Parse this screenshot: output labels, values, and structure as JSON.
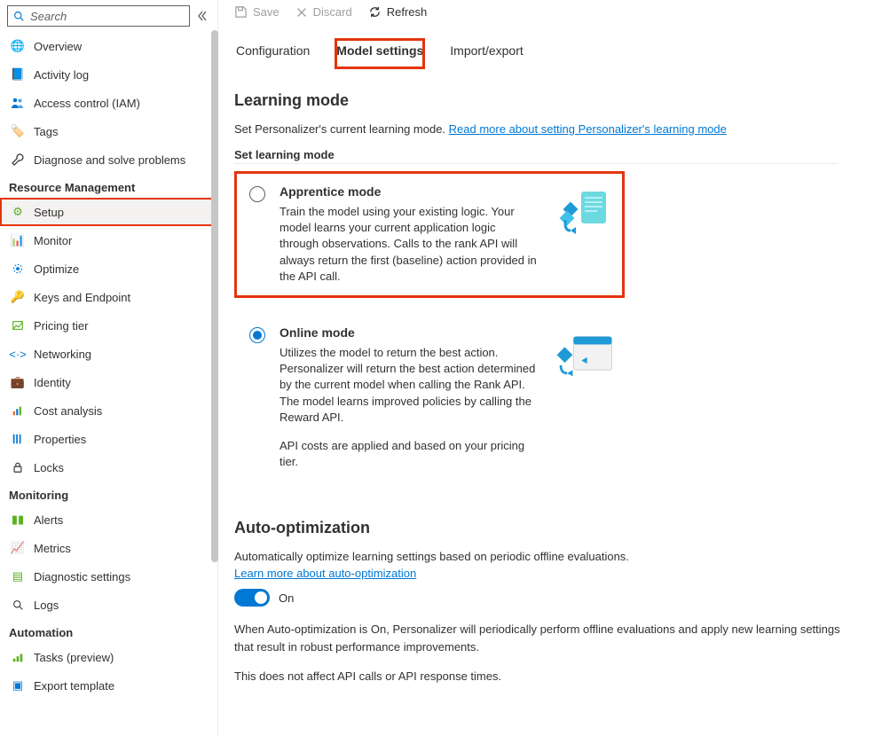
{
  "search": {
    "placeholder": "Search"
  },
  "toolbar": {
    "save": "Save",
    "discard": "Discard",
    "refresh": "Refresh"
  },
  "sidebar": {
    "items_top": [
      {
        "label": "Overview",
        "icon": "globe",
        "color": "#0396dd"
      },
      {
        "label": "Activity log",
        "icon": "log",
        "color": "#0078d4"
      },
      {
        "label": "Access control (IAM)",
        "icon": "people",
        "color": "#0078d4"
      },
      {
        "label": "Tags",
        "icon": "tag",
        "color": "#8c2db5"
      },
      {
        "label": "Diagnose and solve problems",
        "icon": "wrench",
        "color": "#323130"
      }
    ],
    "section_rm": "Resource Management",
    "items_rm": [
      {
        "label": "Setup",
        "icon": "gear",
        "color": "#5bb11f"
      },
      {
        "label": "Monitor",
        "icon": "monitor",
        "color": "#7b83eb"
      },
      {
        "label": "Optimize",
        "icon": "optimize",
        "color": "#0078d4"
      },
      {
        "label": "Keys and Endpoint",
        "icon": "key",
        "color": "#f7b500"
      },
      {
        "label": "Pricing tier",
        "icon": "pricing",
        "color": "#5bb11f"
      },
      {
        "label": "Networking",
        "icon": "network",
        "color": "#0078d4"
      },
      {
        "label": "Identity",
        "icon": "identity",
        "color": "#0078d4"
      },
      {
        "label": "Cost analysis",
        "icon": "cost",
        "color": "#0078d4"
      },
      {
        "label": "Properties",
        "icon": "props",
        "color": "#0078d4"
      },
      {
        "label": "Locks",
        "icon": "lock",
        "color": "#323130"
      }
    ],
    "section_mon": "Monitoring",
    "items_mon": [
      {
        "label": "Alerts",
        "icon": "alerts",
        "color": "#5bb11f"
      },
      {
        "label": "Metrics",
        "icon": "metrics",
        "color": "#0078d4"
      },
      {
        "label": "Diagnostic settings",
        "icon": "diag",
        "color": "#5bb11f"
      },
      {
        "label": "Logs",
        "icon": "logs",
        "color": "#323130"
      }
    ],
    "section_auto": "Automation",
    "items_auto": [
      {
        "label": "Tasks (preview)",
        "icon": "tasks",
        "color": "#5bb11f"
      },
      {
        "label": "Export template",
        "icon": "export",
        "color": "#0078d4"
      }
    ]
  },
  "tabs": {
    "configuration": "Configuration",
    "model_settings": "Model settings",
    "import_export": "Import/export"
  },
  "learning_mode": {
    "heading": "Learning mode",
    "desc_prefix": "Set Personalizer's current learning mode. ",
    "desc_link": "Read more about setting Personalizer's learning mode",
    "field_label": "Set learning mode",
    "apprentice": {
      "title": "Apprentice mode",
      "desc": "Train the model using your existing logic. Your model learns your current application logic through observations. Calls to the rank API will always return the first (baseline) action provided in the API call."
    },
    "online": {
      "title": "Online mode",
      "desc": "Utilizes the model to return the best action. Personalizer will return the best action determined by the current model when calling the Rank API. The model learns improved policies by calling the Reward API.",
      "extra": "API costs are applied and based on your pricing tier."
    }
  },
  "auto_opt": {
    "heading": "Auto-optimization",
    "desc": "Automatically optimize learning settings based on periodic offline evaluations.",
    "link": "Learn more about auto-optimization",
    "toggle_label": "On",
    "para1": "When Auto-optimization is On, Personalizer will periodically perform offline evaluations and apply new learning settings that result in robust performance improvements.",
    "para2": "This does not affect API calls or API response times."
  }
}
